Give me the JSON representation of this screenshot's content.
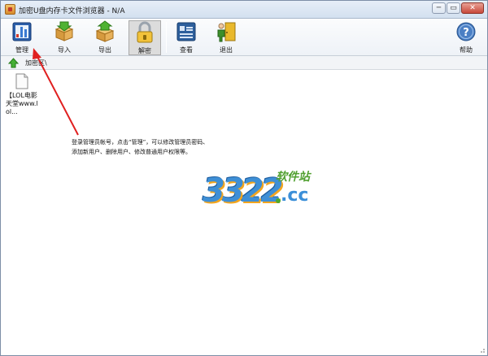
{
  "window": {
    "title": "加密U盘内存卡文件浏览器 - N/A",
    "controls": {
      "minimize": "─",
      "maximize": "▭",
      "close": "✕"
    }
  },
  "toolbar": {
    "buttons": [
      {
        "id": "manage",
        "label": "管理",
        "icon": "manage-board-icon"
      },
      {
        "id": "import",
        "label": "导入",
        "icon": "box-import-icon"
      },
      {
        "id": "export",
        "label": "导出",
        "icon": "box-export-icon"
      },
      {
        "id": "decrypt",
        "label": "解密",
        "icon": "padlock-icon"
      },
      {
        "id": "view",
        "label": "查看",
        "icon": "view-list-icon"
      },
      {
        "id": "exit",
        "label": "退出",
        "icon": "exit-door-icon"
      },
      {
        "id": "help",
        "label": "帮助",
        "icon": "help-icon"
      }
    ]
  },
  "address_bar": {
    "path": "加密区\\"
  },
  "files": [
    {
      "name": "【LOL电影天堂www.lol..."
    }
  ],
  "hint": {
    "line1": "登录管理员帐号，点击“管理”，可以修改管理员密码、",
    "line2": "添加新用户、删除用户、修改普通用户权限等。"
  },
  "watermark": {
    "number": "3322",
    "suffix": ".cc",
    "tagline": "软件站"
  },
  "colors": {
    "arrow": "#e02020",
    "accent_blue": "#3e8fd6",
    "accent_green": "#51a030",
    "accent_orange": "#f2a51f"
  }
}
